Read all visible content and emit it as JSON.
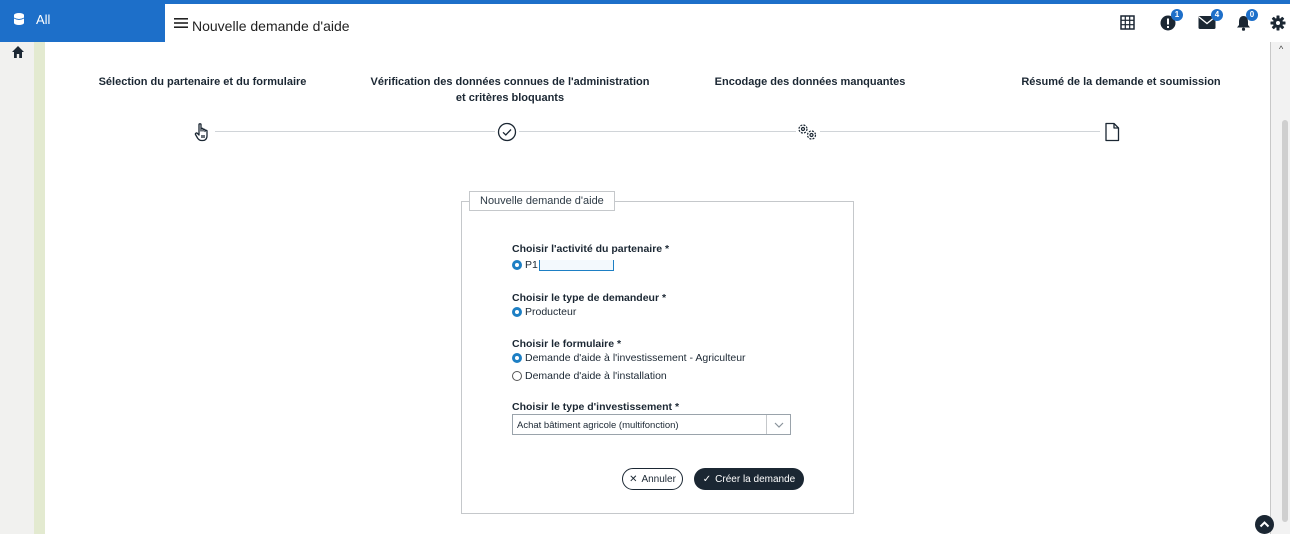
{
  "header": {
    "app_tab": "All",
    "title": "Nouvelle demande d'aide",
    "badges": {
      "alerts": "1",
      "messages": "4",
      "notifications": "0"
    }
  },
  "steps": [
    {
      "label": "Sélection du partenaire et du formulaire",
      "icon": "hand-pointer-icon"
    },
    {
      "label": "Vérification des données connues de l'administration et critères bloquants",
      "icon": "check-circle-icon"
    },
    {
      "label": "Encodage des données manquantes",
      "icon": "gears-icon"
    },
    {
      "label": "Résumé de la demande et soumission",
      "icon": "document-icon"
    }
  ],
  "form": {
    "legend": "Nouvelle demande d'aide",
    "activity": {
      "label": "Choisir l'activité du partenaire *",
      "option": "P1"
    },
    "requester": {
      "label": "Choisir le type de demandeur *",
      "option": "Producteur"
    },
    "formulaire": {
      "label": "Choisir le formulaire *",
      "options": [
        "Demande d'aide à l'investissement - Agriculteur",
        "Demande d'aide à l'installation"
      ]
    },
    "investment": {
      "label": "Choisir le type d'investissement *",
      "selected": "Achat bâtiment agricole (multifonction)"
    },
    "cancel_label": "Annuler",
    "create_label": "Créer la demande"
  },
  "colors": {
    "accent": "#1d6fc9",
    "dark": "#1b2733",
    "radio": "#1d7fc4"
  }
}
